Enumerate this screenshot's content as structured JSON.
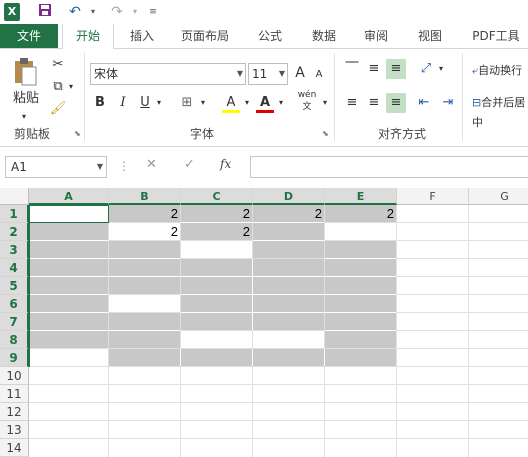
{
  "quick_access": {
    "excel_icon_label": "X",
    "save_icon": "save-icon",
    "undo_icon": "undo-icon",
    "redo_icon": "redo-icon",
    "customize_icon": "customize-icon"
  },
  "tabs": [
    {
      "label": "文件"
    },
    {
      "label": "开始"
    },
    {
      "label": "插入"
    },
    {
      "label": "页面布局"
    },
    {
      "label": "公式"
    },
    {
      "label": "数据"
    },
    {
      "label": "审阅"
    },
    {
      "label": "视图"
    },
    {
      "label": "PDF工具"
    }
  ],
  "ribbon": {
    "clipboard": {
      "paste_label": "粘贴",
      "group_label": "剪贴板"
    },
    "font": {
      "font_name": "宋体",
      "font_size": "11",
      "grow_label": "A",
      "shrink_label": "A",
      "bold_label": "B",
      "italic_label": "I",
      "underline_label": "U",
      "fill_color_label": "A",
      "font_color_label": "A",
      "phonetic_label": "wén",
      "group_label": "字体"
    },
    "alignment": {
      "wrap_text_label": "自动换行",
      "merge_label": "合并后居中",
      "group_label": "对齐方式"
    }
  },
  "formula_bar": {
    "name_box": "A1",
    "cancel_label": "✕",
    "enter_label": "✓",
    "fx_label": "fx",
    "formula": ""
  },
  "sheet": {
    "columns": [
      "A",
      "B",
      "C",
      "D",
      "E",
      "F",
      "G"
    ],
    "rows": [
      "1",
      "2",
      "3",
      "4",
      "5",
      "6",
      "7",
      "8",
      "9",
      "10",
      "11",
      "12",
      "13",
      "14"
    ],
    "cells": {
      "B1": "2",
      "C1": "2",
      "D1": "2",
      "E1": "2",
      "B2": "2",
      "C2": "2"
    },
    "fill_color": "#c8c8c8",
    "accent_color": "#217346"
  }
}
